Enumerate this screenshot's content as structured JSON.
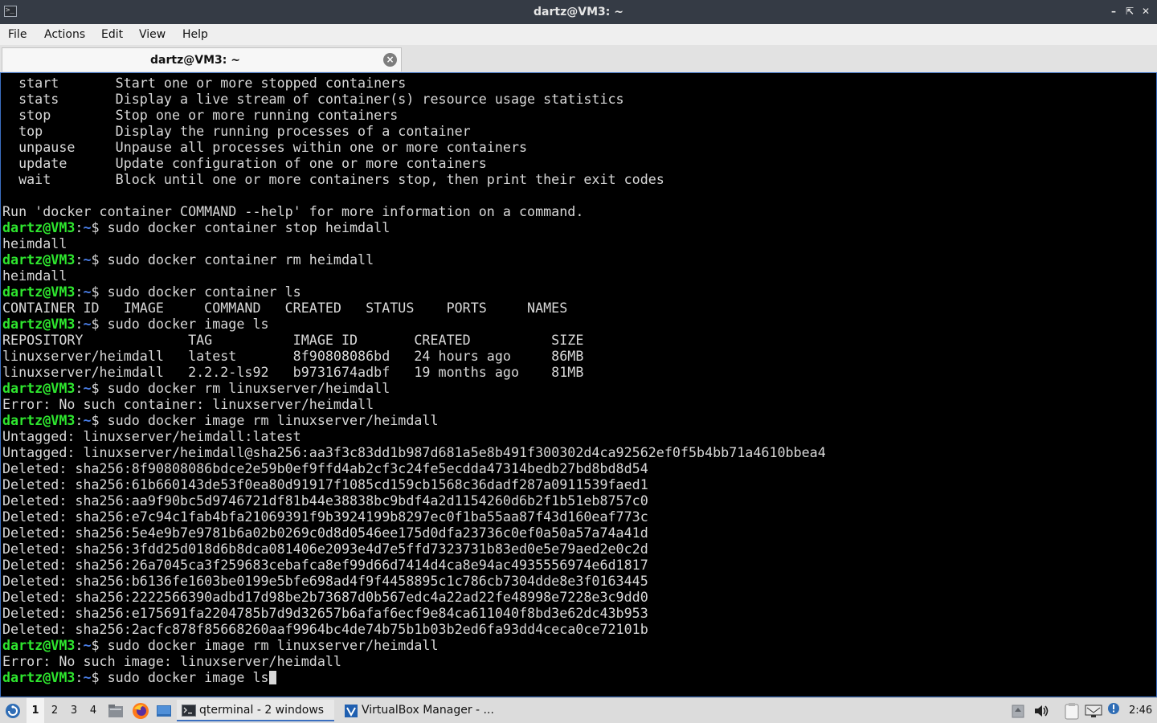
{
  "window": {
    "title": "dartz@VM3: ~",
    "controls": [
      "minimize",
      "restore",
      "close"
    ]
  },
  "menubar": {
    "items": [
      "File",
      "Actions",
      "Edit",
      "View",
      "Help"
    ]
  },
  "tabs": [
    {
      "label": "dartz@VM3: ~",
      "active": true
    }
  ],
  "prompt": {
    "user": "dartz@VM3",
    "colon": ":",
    "path": "~",
    "symbol": "$ "
  },
  "terminal": {
    "lines": [
      {
        "text": "  start       Start one or more stopped containers"
      },
      {
        "text": "  stats       Display a live stream of container(s) resource usage statistics"
      },
      {
        "text": "  stop        Stop one or more running containers"
      },
      {
        "text": "  top         Display the running processes of a container"
      },
      {
        "text": "  unpause     Unpause all processes within one or more containers"
      },
      {
        "text": "  update      Update configuration of one or more containers"
      },
      {
        "text": "  wait        Block until one or more containers stop, then print their exit codes"
      },
      {
        "text": ""
      },
      {
        "text": "Run 'docker container COMMAND --help' for more information on a command."
      },
      {
        "cmd": "sudo docker container stop heimdall"
      },
      {
        "text": "heimdall"
      },
      {
        "cmd": "sudo docker container rm heimdall"
      },
      {
        "text": "heimdall"
      },
      {
        "cmd": "sudo docker container ls"
      },
      {
        "text": "CONTAINER ID   IMAGE     COMMAND   CREATED   STATUS    PORTS     NAMES"
      },
      {
        "cmd": "sudo docker image ls"
      },
      {
        "text": "REPOSITORY             TAG          IMAGE ID       CREATED          SIZE"
      },
      {
        "text": "linuxserver/heimdall   latest       8f90808086bd   24 hours ago     86MB"
      },
      {
        "text": "linuxserver/heimdall   2.2.2-ls92   b9731674adbf   19 months ago    81MB"
      },
      {
        "cmd": "sudo docker rm linuxserver/heimdall"
      },
      {
        "text": "Error: No such container: linuxserver/heimdall"
      },
      {
        "cmd": "sudo docker image rm linuxserver/heimdall"
      },
      {
        "text": "Untagged: linuxserver/heimdall:latest"
      },
      {
        "text": "Untagged: linuxserver/heimdall@sha256:aa3f3c83dd1b987d681a5e8b491f300302d4ca92562ef0f5b4bb71a4610bbea4"
      },
      {
        "text": "Deleted: sha256:8f90808086bdce2e59b0ef9ffd4ab2cf3c24fe5ecdda47314bedb27bd8bd8d54"
      },
      {
        "text": "Deleted: sha256:61b660143de53f0ea80d91917f1085cd159cb1568c36dadf287a0911539faed1"
      },
      {
        "text": "Deleted: sha256:aa9f90bc5d9746721df81b44e38838bc9bdf4a2d1154260d6b2f1b51eb8757c0"
      },
      {
        "text": "Deleted: sha256:e7c94c1fab4bfa21069391f9b3924199b8297ec0f1ba55aa87f43d160eaf773c"
      },
      {
        "text": "Deleted: sha256:5e4e9b7e9781b6a02b0269c0d8d0546ee175d0dfa23736c0ef0a50a57a74a41d"
      },
      {
        "text": "Deleted: sha256:3fdd25d018d6b8dca081406e2093e4d7e5ffd7323731b83ed0e5e79aed2e0c2d"
      },
      {
        "text": "Deleted: sha256:26a7045ca3f259683cebafca8ef99d66d7414d4ca8e94ac4935556974e6d1817"
      },
      {
        "text": "Deleted: sha256:b6136fe1603be0199e5bfe698ad4f9f4458895c1c786cb7304dde8e3f0163445"
      },
      {
        "text": "Deleted: sha256:2222566390adbd17d98be2b73687d0b567edc4a22ad22fe48998e7228e3c9dd0"
      },
      {
        "text": "Deleted: sha256:e175691fa2204785b7d9d32657b6afaf6ecf9e84ca611040f8bd3e62dc43b953"
      },
      {
        "text": "Deleted: sha256:2acfc878f85668260aaf9964bc4de74b75b1b03b2ed6fa93dd4ceca0ce72101b"
      },
      {
        "cmd": "sudo docker image rm linuxserver/heimdall"
      },
      {
        "text": "Error: No such image: linuxserver/heimdall"
      },
      {
        "cmd": "sudo docker image ls",
        "cursor": true
      }
    ]
  },
  "taskbar": {
    "menu_icon": "lxqt-menu-icon",
    "desktops": [
      "1",
      "2",
      "3",
      "4"
    ],
    "active_desktop": "1",
    "launchers": [
      "file-manager-icon",
      "firefox-icon",
      "show-desktop-icon"
    ],
    "tasks": [
      {
        "label": "qterminal - 2 windows",
        "icon": "terminal-icon",
        "active": true
      },
      {
        "label": "VirtualBox Manager - ...",
        "icon": "virtualbox-icon",
        "active": false
      }
    ],
    "tray": [
      "removable-media-icon",
      "volume-icon",
      "clipboard-icon",
      "network-icon",
      "notification-icon"
    ],
    "clock": "2:46"
  },
  "colors": {
    "titlebar": "#353b45",
    "terminal_bg": "#000000",
    "terminal_fg": "#d8d8d8",
    "prompt_user": "#2ee62e",
    "prompt_path": "#4a7fe8",
    "accent": "#3b6fc0"
  }
}
